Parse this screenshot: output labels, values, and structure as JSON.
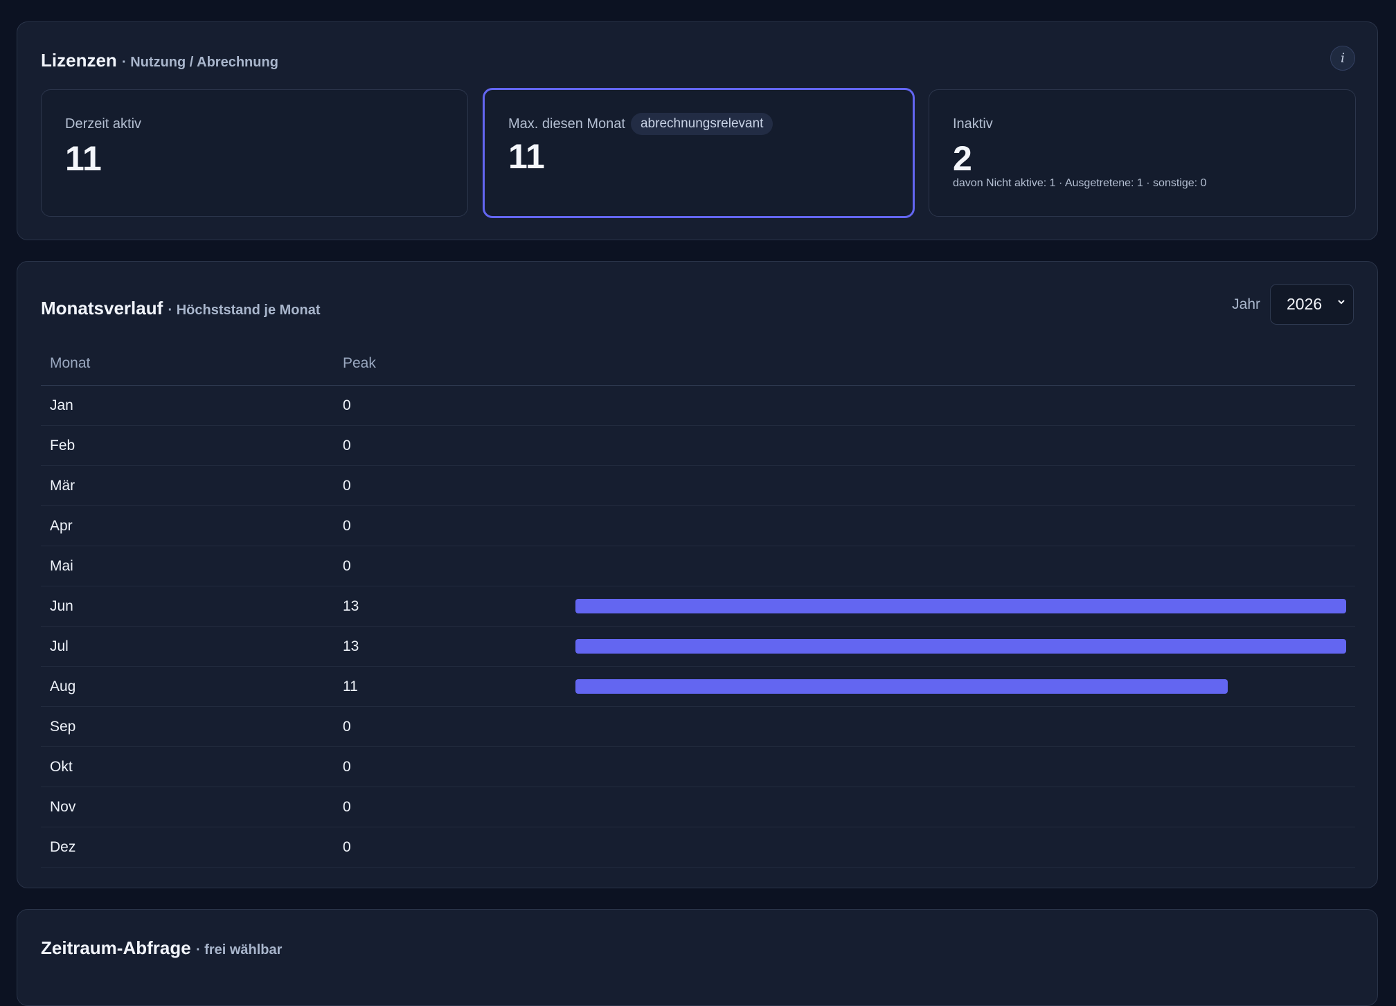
{
  "licenses": {
    "title": "Lizenzen",
    "subtitle": "· Nutzung / Abrechnung",
    "info_label": "i",
    "active": {
      "label": "Derzeit aktiv",
      "value": "11"
    },
    "max_month": {
      "label": "Max. diesen Monat",
      "badge": "abrechnungsrelevant",
      "value": "11"
    },
    "inactive": {
      "label": "Inaktiv",
      "value": "2",
      "detail": "davon Nicht aktive: 1 · Ausgetretene: 1 · sonstige: 0"
    }
  },
  "monthly": {
    "title": "Monatsverlauf",
    "subtitle": "· Höchststand je Monat",
    "year_label": "Jahr",
    "year_value": "2026",
    "columns": [
      "Monat",
      "Peak"
    ],
    "rows": [
      {
        "month": "Jan",
        "peak": "0"
      },
      {
        "month": "Feb",
        "peak": "0"
      },
      {
        "month": "Mär",
        "peak": "0"
      },
      {
        "month": "Apr",
        "peak": "0"
      },
      {
        "month": "Mai",
        "peak": "0"
      },
      {
        "month": "Jun",
        "peak": "13"
      },
      {
        "month": "Jul",
        "peak": "13"
      },
      {
        "month": "Aug",
        "peak": "11"
      },
      {
        "month": "Sep",
        "peak": "0"
      },
      {
        "month": "Okt",
        "peak": "0"
      },
      {
        "month": "Nov",
        "peak": "0"
      },
      {
        "month": "Dez",
        "peak": "0"
      }
    ]
  },
  "range_query": {
    "title": "Zeitraum-Abfrage",
    "subtitle": "· frei wählbar"
  },
  "colors": {
    "accent": "#6366f1",
    "background": "#0c1222",
    "card": "#161e30"
  }
}
